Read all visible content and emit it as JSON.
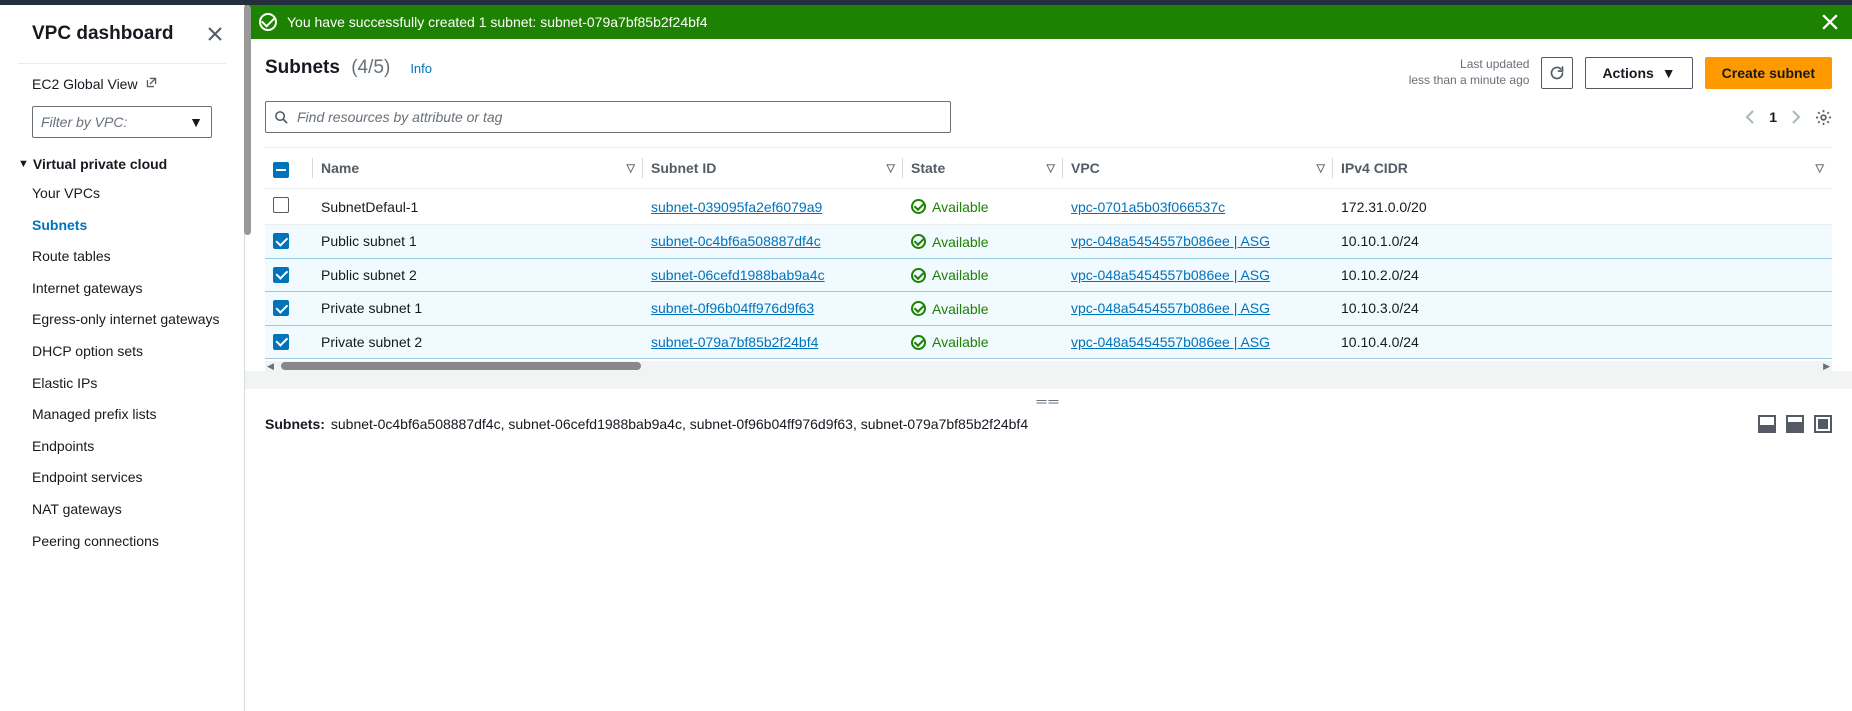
{
  "sidebar": {
    "title": "VPC dashboard",
    "ec2_link": "EC2 Global View",
    "filter_placeholder": "Filter by VPC:",
    "section_label": "Virtual private cloud",
    "items": [
      "Your VPCs",
      "Subnets",
      "Route tables",
      "Internet gateways",
      "Egress-only internet gateways",
      "DHCP option sets",
      "Elastic IPs",
      "Managed prefix lists",
      "Endpoints",
      "Endpoint services",
      "NAT gateways",
      "Peering connections"
    ],
    "active_index": 1
  },
  "flash": {
    "message": "You have successfully created 1 subnet: subnet-079a7bf85b2f24bf4"
  },
  "header": {
    "title": "Subnets",
    "count": "(4/5)",
    "info": "Info",
    "updated_line1": "Last updated",
    "updated_line2": "less than a minute ago",
    "actions_label": "Actions",
    "create_label": "Create subnet"
  },
  "search": {
    "placeholder": "Find resources by attribute or tag"
  },
  "pager": {
    "page": "1"
  },
  "table": {
    "columns": [
      "Name",
      "Subnet ID",
      "State",
      "VPC",
      "IPv4 CIDR"
    ],
    "rows": [
      {
        "selected": false,
        "name": "SubnetDefaul-1",
        "subnet_id": "subnet-039095fa2ef6079a9",
        "state": "Available",
        "vpc": "vpc-0701a5b03f066537c",
        "cidr": "172.31.0.0/20"
      },
      {
        "selected": true,
        "name": "Public subnet 1",
        "subnet_id": "subnet-0c4bf6a508887df4c",
        "state": "Available",
        "vpc": "vpc-048a5454557b086ee | ASG",
        "cidr": "10.10.1.0/24"
      },
      {
        "selected": true,
        "name": "Public subnet 2",
        "subnet_id": "subnet-06cefd1988bab9a4c",
        "state": "Available",
        "vpc": "vpc-048a5454557b086ee | ASG",
        "cidr": "10.10.2.0/24"
      },
      {
        "selected": true,
        "name": "Private subnet 1",
        "subnet_id": "subnet-0f96b04ff976d9f63",
        "state": "Available",
        "vpc": "vpc-048a5454557b086ee | ASG",
        "cidr": "10.10.3.0/24"
      },
      {
        "selected": true,
        "name": "Private subnet 2",
        "subnet_id": "subnet-079a7bf85b2f24bf4",
        "state": "Available",
        "vpc": "vpc-048a5454557b086ee | ASG",
        "cidr": "10.10.4.0/24"
      }
    ]
  },
  "details": {
    "label": "Subnets:",
    "selection": "subnet-0c4bf6a508887df4c, subnet-06cefd1988bab9a4c, subnet-0f96b04ff976d9f63, subnet-079a7bf85b2f24bf4"
  }
}
